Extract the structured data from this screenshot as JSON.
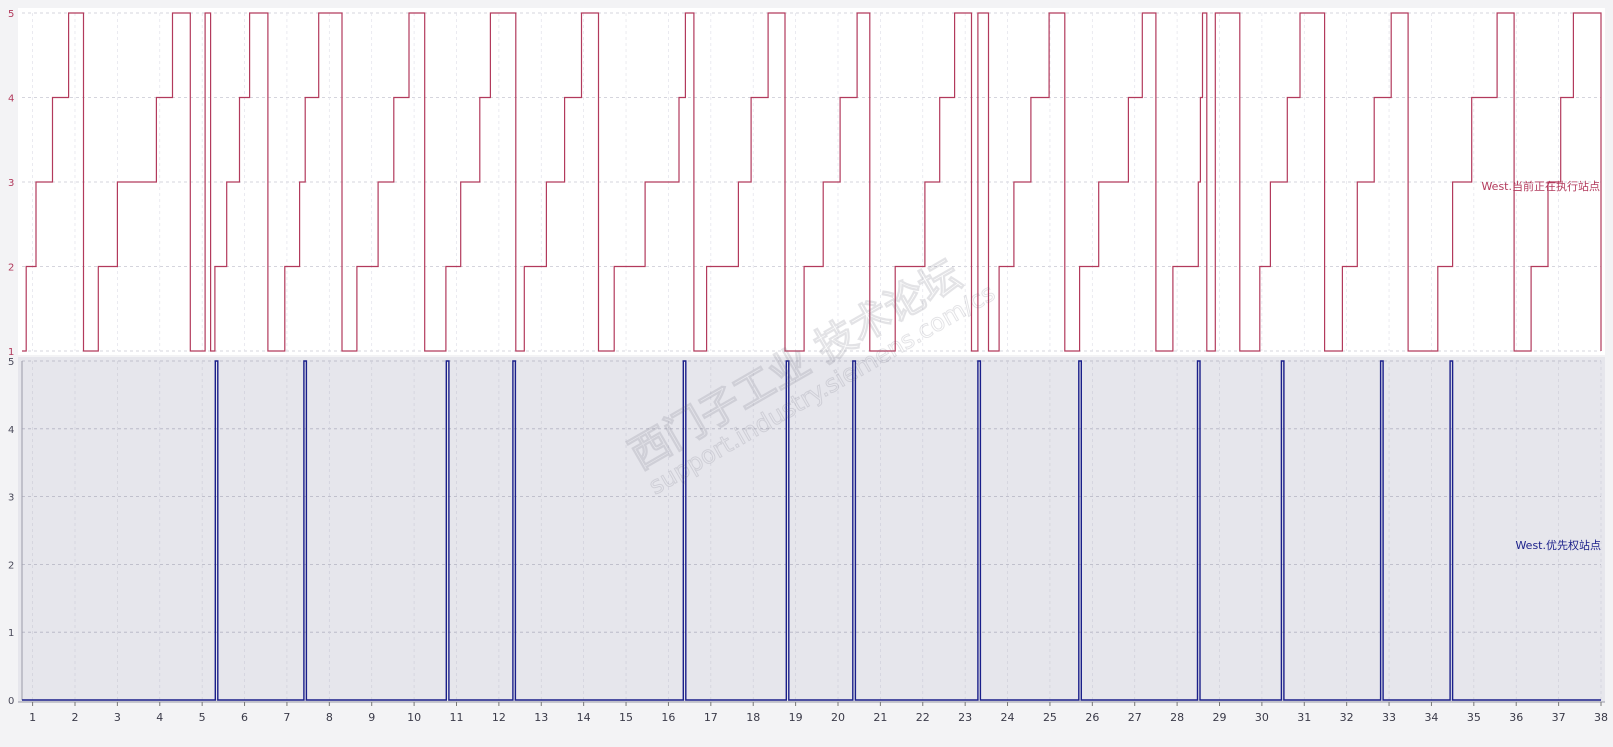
{
  "colors": {
    "upper_series": "#b23a5c",
    "lower_series": "#1a1f8a",
    "upper_bg": "#ffffff",
    "lower_bg": "#e6e6ec",
    "grid": "#c8c8d2"
  },
  "watermark": {
    "line1": "西门子工业 技术论坛",
    "line2": "support.industry.siemens.com/cs"
  },
  "chart_data": [
    {
      "type": "line",
      "step": true,
      "panel": "upper",
      "series_label": "West.当前正在执行站点",
      "xlim": [
        0.75,
        38.0
      ],
      "ylim": [
        1,
        5
      ],
      "yticks": [
        "1",
        "2",
        "3",
        "4",
        "5"
      ],
      "grid": true,
      "x": [
        0.75,
        0.85,
        1.08,
        1.47,
        1.85,
        2.2,
        2.55,
        3.0,
        3.92,
        4.3,
        4.72,
        5.07,
        5.2,
        5.3,
        5.58,
        5.88,
        6.12,
        6.55,
        6.95,
        7.3,
        7.43,
        7.75,
        8.3,
        8.65,
        9.15,
        9.52,
        9.88,
        10.25,
        10.75,
        11.1,
        11.55,
        11.8,
        12.4,
        12.6,
        13.12,
        13.55,
        13.95,
        14.35,
        14.72,
        15.45,
        16.25,
        16.4,
        16.6,
        16.9,
        17.65,
        17.95,
        18.35,
        18.75,
        19.2,
        19.65,
        20.05,
        20.45,
        20.75,
        21.35,
        22.05,
        22.4,
        22.75,
        23.15,
        23.3,
        23.55,
        23.8,
        24.15,
        24.55,
        24.98,
        25.35,
        25.7,
        26.15,
        26.85,
        27.18,
        27.5,
        27.9,
        28.5,
        28.55,
        28.6,
        28.7,
        28.9,
        29.48,
        29.95,
        30.2,
        30.6,
        30.9,
        31.48,
        31.9,
        32.25,
        32.65,
        33.05,
        33.45,
        34.15,
        34.5,
        34.95,
        35.55,
        35.95,
        36.35,
        36.75,
        37.05,
        37.35,
        38.0
      ],
      "y": [
        1,
        2,
        3,
        4,
        5,
        1,
        2,
        3,
        4,
        5,
        1,
        5,
        1,
        2,
        3,
        4,
        5,
        1,
        2,
        3,
        4,
        5,
        1,
        2,
        3,
        4,
        5,
        1,
        2,
        3,
        4,
        5,
        1,
        2,
        3,
        4,
        5,
        1,
        2,
        3,
        4,
        5,
        1,
        2,
        3,
        4,
        5,
        1,
        2,
        3,
        4,
        5,
        1,
        2,
        3,
        4,
        5,
        1,
        5,
        1,
        2,
        3,
        4,
        5,
        1,
        2,
        3,
        4,
        5,
        1,
        2,
        3,
        4,
        5,
        1,
        5,
        1,
        2,
        3,
        4,
        5,
        1,
        2,
        3,
        4,
        5,
        1,
        2,
        3,
        4,
        5,
        1,
        2,
        3,
        4,
        5,
        1,
        2,
        2
      ]
    },
    {
      "type": "line",
      "step": true,
      "panel": "lower",
      "series_label": "West.优先权站点",
      "xlim": [
        0.75,
        38.0
      ],
      "ylim": [
        0,
        5
      ],
      "yticks": [
        "0",
        "1",
        "2",
        "3",
        "4",
        "5"
      ],
      "xticks": [
        "1",
        "2",
        "3",
        "4",
        "5",
        "6",
        "7",
        "8",
        "9",
        "10",
        "11",
        "12",
        "13",
        "14",
        "15",
        "16",
        "17",
        "18",
        "19",
        "20",
        "21",
        "22",
        "23",
        "24",
        "25",
        "26",
        "27",
        "28",
        "29",
        "30",
        "31",
        "32",
        "33",
        "34",
        "35",
        "36",
        "37",
        "38"
      ],
      "grid": true,
      "pulses": [
        5.31,
        7.4,
        10.76,
        12.33,
        16.35,
        18.78,
        20.35,
        23.3,
        25.68,
        28.48,
        30.46,
        32.8,
        34.44
      ],
      "pulse_width": 0.06,
      "low": 0,
      "high": 5
    }
  ]
}
